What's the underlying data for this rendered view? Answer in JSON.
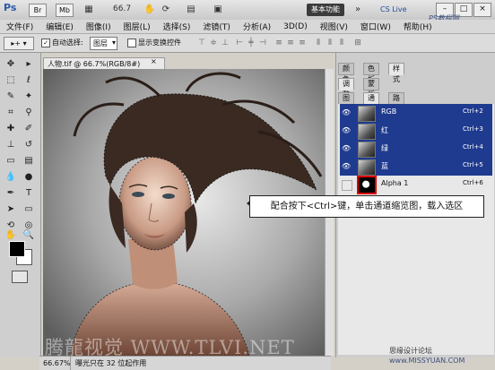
{
  "app": {
    "logo": "Ps",
    "zoom": "66.7",
    "workspace_label": "基本功能",
    "cslive_label": "CS Live",
    "window_controls": [
      "–",
      "□",
      "×"
    ],
    "watermark_top": "PS教程网 BBS.16XX8.COM"
  },
  "menu": [
    "文件(F)",
    "编辑(E)",
    "图像(I)",
    "图层(L)",
    "选择(S)",
    "滤镜(T)",
    "分析(A)",
    "3D(D)",
    "视图(V)",
    "窗口(W)",
    "帮助(H)"
  ],
  "options": {
    "auto_select_label": "自动选择:",
    "auto_select_value": "图层",
    "show_transform_label": "显示变换控件"
  },
  "document": {
    "tab_title": "人物.tif @ 66.7%(RGB/8#)",
    "close": "×",
    "zoom_status": "66.67%",
    "status_text": "曝光只在 32 位起作用"
  },
  "panels": {
    "top_tabs": [
      "颜色",
      "色板",
      "样式"
    ],
    "mid_tabs": [
      "调整",
      "蒙版"
    ],
    "layer_tabs": [
      "图层",
      "通道",
      "路径"
    ],
    "channels": [
      {
        "name": "RGB",
        "shortcut": "Ctrl+2",
        "visible": true,
        "selected": true
      },
      {
        "name": "红",
        "shortcut": "Ctrl+3",
        "visible": true,
        "selected": true
      },
      {
        "name": "绿",
        "shortcut": "Ctrl+4",
        "visible": true,
        "selected": true
      },
      {
        "name": "蓝",
        "shortcut": "Ctrl+5",
        "visible": true,
        "selected": true
      },
      {
        "name": "Alpha 1",
        "shortcut": "Ctrl+6",
        "visible": false,
        "selected": false
      }
    ]
  },
  "callout": "配合按下<Ctrl>键，单击通道缩览图，载入选区",
  "watermarks": {
    "bottom": "腾龍视觉 WWW.TLVI.NET",
    "bottom_right_1": "思缘设计论坛",
    "bottom_right_2": "www.MISSYUAN.COM"
  },
  "icons": {
    "move_tool": "move-icon",
    "marquee": "marquee-icon",
    "lasso": "lasso-icon",
    "quick_select": "quick-select-icon",
    "crop": "crop-icon",
    "eyedropper": "eyedropper-icon",
    "brush": "brush-icon",
    "stamp": "stamp-icon",
    "eraser": "eraser-icon",
    "gradient": "gradient-icon",
    "dodge": "dodge-icon",
    "pen": "pen-icon",
    "type": "type-icon",
    "path_select": "path-select-icon",
    "shape": "shape-icon",
    "hand": "hand-icon",
    "zoom": "zoom-icon"
  },
  "colors": {
    "selection_blue": "#1f3b8f",
    "highlight_red": "#e00000"
  }
}
